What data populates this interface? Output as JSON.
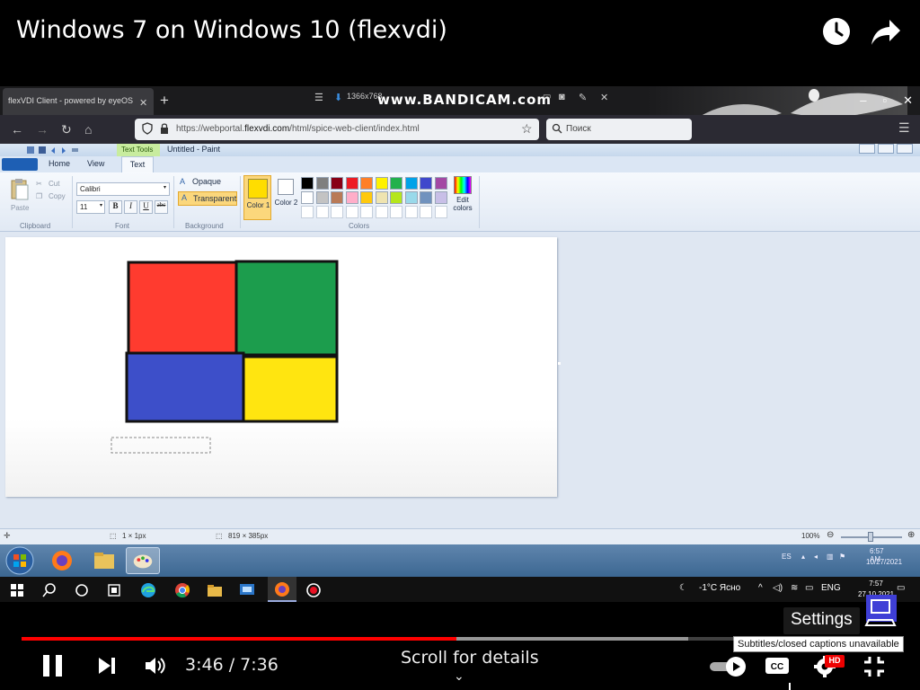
{
  "video": {
    "title": "Windows 7 on Windows 10 (flexvdi)",
    "watch_later_icon": "clock-icon",
    "share_icon": "share-arrow-icon"
  },
  "firefox": {
    "tab_title": "flexVDI Client - powered by eyeOS",
    "url_prefix": "https://webportal.",
    "url_host": "flexvdi.com",
    "url_path": "/html/spice-web-client/index.html",
    "search_placeholder": "Поиск",
    "nav_icons": [
      "back-arrow-icon",
      "forward-arrow-icon",
      "reload-icon",
      "home-icon"
    ]
  },
  "bandicam": {
    "resolution": "1366x768",
    "logo": "www.BANDICAM.com"
  },
  "paint": {
    "window_title": "Untitled - Paint",
    "text_tools_tab": "Text Tools",
    "tabs": [
      "Home",
      "View",
      "Text"
    ],
    "clipboard": {
      "paste": "Paste",
      "cut": "Cut",
      "copy": "Copy",
      "group": "Clipboard"
    },
    "font": {
      "family": "Calibri",
      "size": "11",
      "bold": "B",
      "italic": "I",
      "underline": "U",
      "strike": "abc",
      "group": "Font"
    },
    "background": {
      "opaque": "Opaque",
      "transparent": "Transparent",
      "group": "Background"
    },
    "colors": {
      "color1_label": "Color 1",
      "color2_label": "Color 2",
      "edit_label": "Edit colors",
      "group": "Colors",
      "color1": "#ffdd00",
      "color2": "#ffffff",
      "palette_row1": [
        "#000000",
        "#7f7f7f",
        "#880015",
        "#ed1c24",
        "#ff7f27",
        "#fff200",
        "#22b14c",
        "#00a2e8",
        "#3f48cc",
        "#a349a4"
      ],
      "palette_row2": [
        "#ffffff",
        "#c3c3c3",
        "#b97a57",
        "#ffaec9",
        "#ffc90e",
        "#efe4b0",
        "#b5e61d",
        "#99d9ea",
        "#7092be",
        "#c8bfe7"
      ]
    },
    "shapes": {
      "red": "#ff3b2f",
      "green": "#1c9d4d",
      "blue": "#3d4fc9",
      "yellow": "#ffe510"
    },
    "status": {
      "cursor_pos": "1 × 1px",
      "canvas_size": "819 × 385px",
      "zoom": "100%"
    }
  },
  "win7": {
    "tray_lang": "ES",
    "clock_time": "6:57 AM",
    "clock_date": "10/27/2021"
  },
  "win10": {
    "weather": "-1°C Ясно",
    "lang": "ENG",
    "clock_time": "7:57",
    "clock_date": "27.10.2021"
  },
  "player": {
    "current_time": "3:46",
    "duration": "7:36",
    "time_display": "3:46 / 7:36",
    "progress_fraction": 0.496,
    "buffered_fraction": 0.76,
    "scroll_hint": "Scroll for details",
    "settings_tooltip": "Settings",
    "cc_tooltip": "Subtitles/closed captions unavailable",
    "hd_badge": "HD"
  }
}
